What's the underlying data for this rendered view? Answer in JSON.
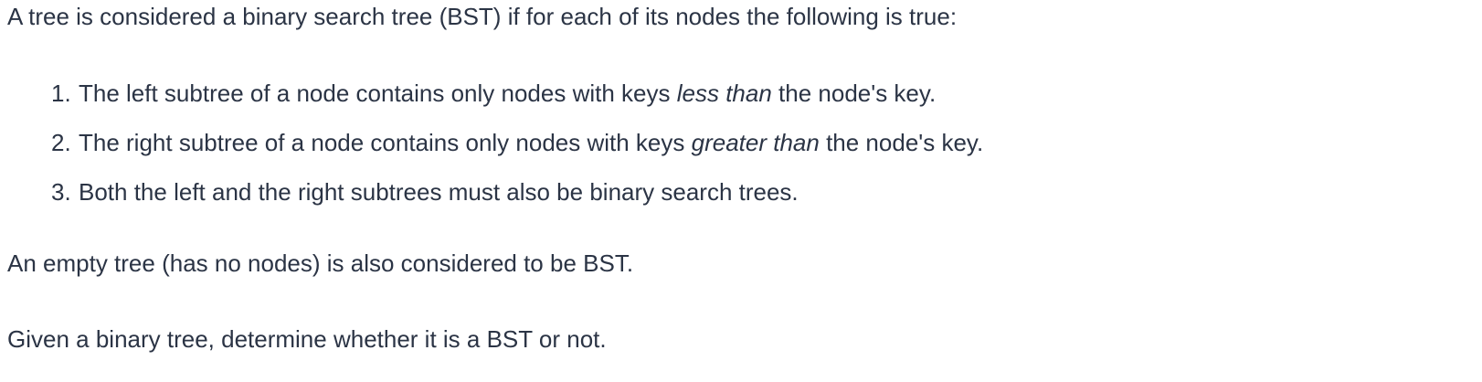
{
  "intro": "A tree is considered a binary search tree (BST) if for each of its nodes the following is true:",
  "rules": [
    {
      "number": "1.",
      "before": "The left subtree of a node contains only nodes with keys ",
      "emphasis": "less than",
      "after": " the node's key."
    },
    {
      "number": "2.",
      "before": "The right subtree of a node contains only nodes with keys ",
      "emphasis": "greater than",
      "after": " the node's key."
    },
    {
      "number": "3.",
      "before": "Both the left and the right subtrees must also be binary search trees.",
      "emphasis": "",
      "after": ""
    }
  ],
  "empty_tree_note": "An empty tree (has no nodes) is also considered to be BST.",
  "task": "Given a binary tree, determine whether it is a BST or not.",
  "colors": {
    "text": "#2b3445",
    "background": "#ffffff"
  }
}
